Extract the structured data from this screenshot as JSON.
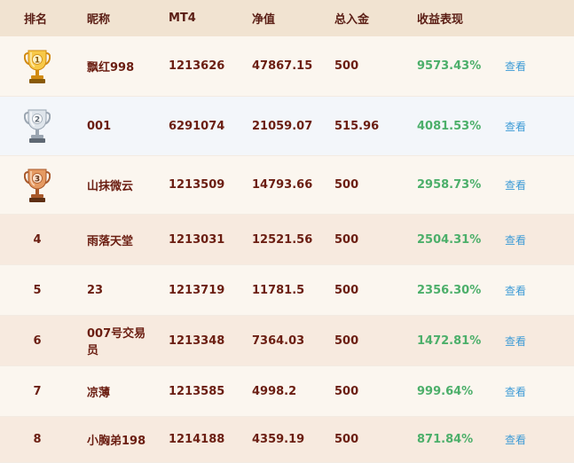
{
  "header": {
    "rank": "排名",
    "nickname": "昵称",
    "mt4": "MT4",
    "nav": "净值",
    "deposit": "总入金",
    "performance": "收益表现"
  },
  "colors": {
    "gold": "#e6a321",
    "silver": "#aab3bd",
    "bronze": "#b8683a",
    "return_green": "#4caf6a",
    "link_blue": "#3d9bd6",
    "text_maroon": "#6b1e12"
  },
  "rows": [
    {
      "rank": "1",
      "medal": "gold",
      "nickname": "飘红998",
      "mt4": "1213626",
      "nav": "47867.15",
      "deposit": "500",
      "return": "9573.43%",
      "action": "查看"
    },
    {
      "rank": "2",
      "medal": "silver",
      "nickname": "001",
      "mt4": "6291074",
      "nav": "21059.07",
      "deposit": "515.96",
      "return": "4081.53%",
      "action": "查看"
    },
    {
      "rank": "3",
      "medal": "bronze",
      "nickname": "山抹微云",
      "mt4": "1213509",
      "nav": "14793.66",
      "deposit": "500",
      "return": "2958.73%",
      "action": "查看"
    },
    {
      "rank": "4",
      "medal": "",
      "nickname": "雨落天堂",
      "mt4": "1213031",
      "nav": "12521.56",
      "deposit": "500",
      "return": "2504.31%",
      "action": "查看"
    },
    {
      "rank": "5",
      "medal": "",
      "nickname": "23",
      "mt4": "1213719",
      "nav": "11781.5",
      "deposit": "500",
      "return": "2356.30%",
      "action": "查看"
    },
    {
      "rank": "6",
      "medal": "",
      "nickname": "007号交易员",
      "mt4": "1213348",
      "nav": "7364.03",
      "deposit": "500",
      "return": "1472.81%",
      "action": "查看"
    },
    {
      "rank": "7",
      "medal": "",
      "nickname": "凉薄",
      "mt4": "1213585",
      "nav": "4998.2",
      "deposit": "500",
      "return": "999.64%",
      "action": "查看"
    },
    {
      "rank": "8",
      "medal": "",
      "nickname": "小胸弟198",
      "mt4": "1214188",
      "nav": "4359.19",
      "deposit": "500",
      "return": "871.84%",
      "action": "查看"
    }
  ]
}
